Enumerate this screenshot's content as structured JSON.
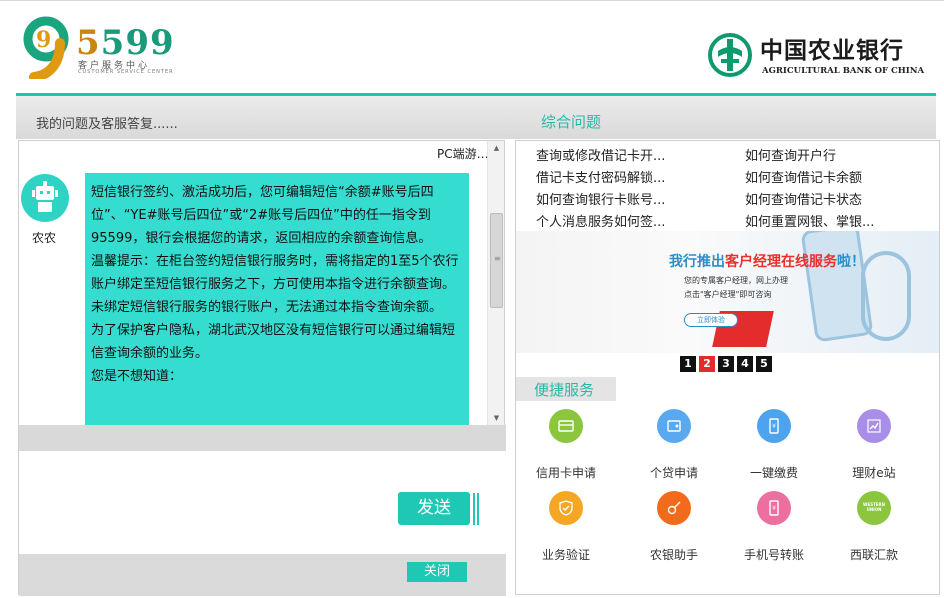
{
  "header": {
    "hotline_digit": "9",
    "hotline_digits": [
      "5",
      "599"
    ],
    "hotline_sub": "客户服务中心",
    "hotline_sub_en": "CUSTOMER SERVICE CENTER",
    "bank_name_cn": "中国农业银行",
    "bank_name_en": "AGRICULTURAL BANK OF CHINA"
  },
  "titlebar": {
    "left": "我的问题及客服答复......",
    "center": "综合问题"
  },
  "chat": {
    "channel_tag": "PC端游…",
    "agent_name": "农农",
    "message_lines": [
      "短信银行签约、激活成功后，您可编辑短信“余额#账号后四位”、“YE#账号后四位”或“2#账号后四位”中的任一指令到95599，银行会根据您的请求，返回相应的余额查询信息。",
      "温馨提示：在柜台签约短信银行服务时，需将指定的1至5个农行账户绑定至短信银行服务之下，方可使用本指令进行余额查询。未绑定短信银行服务的银行账户，无法通过本指令查询余额。",
      "为了保护客户隐私，湖北武汉地区没有短信银行可以通过编辑短信查询余额的业务。",
      "您是不想知道："
    ],
    "send_label": "发送",
    "close_label": "关闭"
  },
  "faq": {
    "items": [
      "查询或修改借记卡开...",
      "如何查询开户行",
      "借记卡支付密码解锁...",
      "如何查询借记卡余额",
      "如何查询银行卡账号...",
      "如何查询借记卡状态",
      "个人消息服务如何签...",
      "如何重置网银、掌银..."
    ]
  },
  "banner": {
    "title_prefix": "我行推出",
    "title_highlight": "客户经理在线服务",
    "title_suffix": "啦！",
    "line1": "您的专属客户经理，网上办理",
    "line2": "点击\"客户经理\"即可咨询",
    "button": "立即体验"
  },
  "pager": [
    "1",
    "2",
    "3",
    "4",
    "5"
  ],
  "pager_active": 1,
  "quick": {
    "title": "便捷服务",
    "services": [
      {
        "label": "信用卡申请",
        "icon": "credit-card-icon",
        "color": "#8cc63f"
      },
      {
        "label": "个贷申请",
        "icon": "wallet-icon",
        "color": "#5aa9f0"
      },
      {
        "label": "一键缴费",
        "icon": "payment-phone-icon",
        "color": "#4ea3ee"
      },
      {
        "label": "理财e站",
        "icon": "chart-up-icon",
        "color": "#a98ee8"
      },
      {
        "label": "业务验证",
        "icon": "shield-check-icon",
        "color": "#f5a623"
      },
      {
        "label": "农银助手",
        "icon": "key-icon",
        "color": "#f26a1b"
      },
      {
        "label": "手机号转账",
        "icon": "phone-transfer-icon",
        "color": "#ec6fa0"
      },
      {
        "label": "西联汇款",
        "icon": "western-union-icon",
        "color": "#8cc63f",
        "icon_text": [
          "WESTERN",
          "UNION"
        ]
      }
    ]
  }
}
